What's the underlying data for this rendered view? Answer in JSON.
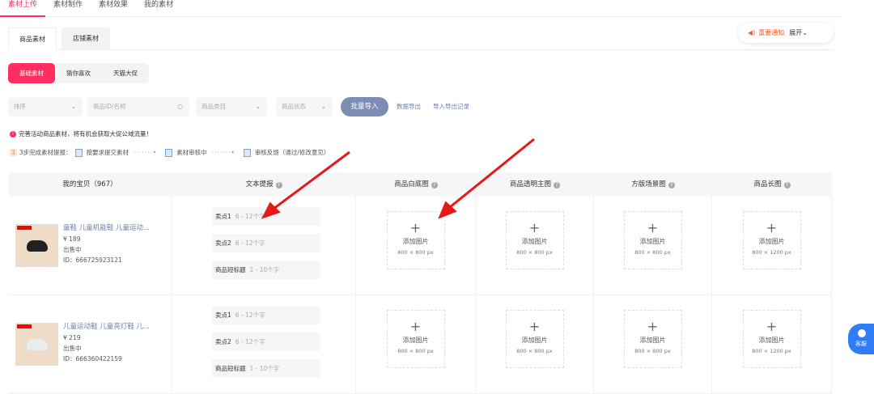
{
  "topnav": [
    "素材上传",
    "素材制作",
    "素材效果",
    "我的素材"
  ],
  "subtabs": [
    "商品素材",
    "店铺素材"
  ],
  "notice": {
    "title": "重要通知",
    "expand": "展开"
  },
  "segments": [
    "基础素材",
    "猜你喜欢",
    "天猫大促"
  ],
  "filters": {
    "sort": "排序",
    "search": "商品ID/名称",
    "category": "商品类目",
    "status": "商品状态"
  },
  "actions": {
    "import": "批量导入",
    "export": "数据导出",
    "records": "导入导出记录"
  },
  "tip": "完善活动商品素材，将有机会获取大促公域流量！",
  "steps": {
    "label": "3步完成素材提报：",
    "step_num": "3",
    "s1": "按要求提交素材",
    "s2": "素材审核中",
    "s3": "审核反馈（通过/修改意见）"
  },
  "columns": [
    "我的宝贝（967）",
    "文本提报",
    "商品白底图",
    "商品透明主图",
    "方版场景图",
    "商品长图"
  ],
  "upload": {
    "label": "添加图片",
    "size_sq": "800 × 800 px",
    "size_long": "800 × 1200 px"
  },
  "text_fields": [
    {
      "label": "卖点1",
      "hint": "6 - 12个字"
    },
    {
      "label": "卖点2",
      "hint": "6 - 12个字"
    },
    {
      "label": "商品短标题",
      "hint": "1 - 10个字"
    }
  ],
  "products": [
    {
      "name": "童鞋 儿童机能鞋 儿童运动...",
      "price": "¥ 189",
      "status": "出售中",
      "id": "ID：666725923121",
      "shoe": "#222"
    },
    {
      "name": "儿童运动鞋 儿童亮灯鞋 儿...",
      "price": "¥ 219",
      "status": "出售中",
      "id": "ID：666360422159",
      "shoe": "#e8eef0"
    }
  ],
  "customer_service": "客服"
}
